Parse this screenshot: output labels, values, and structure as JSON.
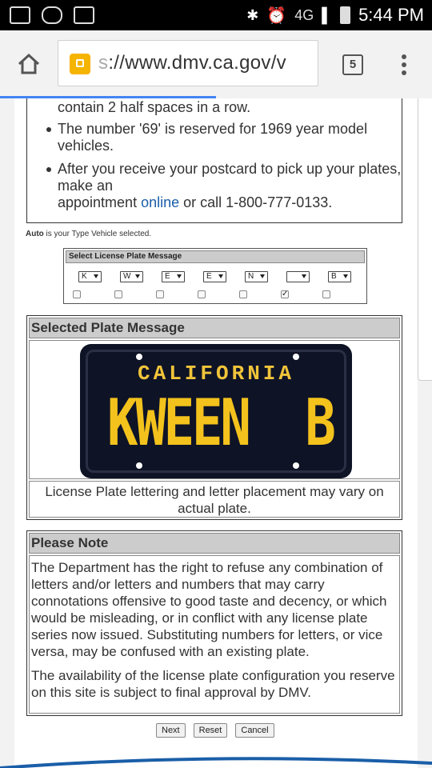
{
  "status_bar": {
    "network": "4G",
    "time": "5:44 PM"
  },
  "browser": {
    "url_prefix": "s",
    "url": "://www.dmv.ca.gov/v",
    "tab_count": "5"
  },
  "info_box": {
    "line_partial": "contain 2 half spaces in a row.",
    "bullet_69": "The number '69' is reserved for 1969 year model vehicles.",
    "bullet_69_line1": "The number '69' is reserved for 1969 year model",
    "bullet_69_line2": "vehicles.",
    "bullet_postcard_line1": "After you receive your postcard to pick up your plates,",
    "bullet_postcard_line2": "make an",
    "bullet_postcard_line3_pre": "appointment ",
    "link_online": "online",
    "bullet_postcard_line3_post": " or call 1-800-777-0133."
  },
  "vehicle_type": {
    "value": "Auto",
    "suffix": " is your Type Vehicle selected."
  },
  "selector": {
    "title": "Select License Plate Message",
    "chars": [
      "K",
      "W",
      "E",
      "E",
      "N",
      "",
      "B"
    ],
    "half_space_checked": [
      false,
      false,
      false,
      false,
      false,
      true,
      false
    ]
  },
  "selected_plate": {
    "heading": "Selected Plate Message",
    "state_name": "CALIFORNIA",
    "plate_text": "KWEEN  B",
    "caption": "License Plate lettering and letter placement may vary on actual plate."
  },
  "please_note": {
    "heading": "Please Note",
    "paragraph1": "The Department has the right to refuse any combination of letters and/or letters and numbers that may carry connotations offensive to good taste and decency, or which would be misleading, or in conflict with any license plate series now issued. Substituting numbers for letters, or vice versa, may be confused with an existing plate.",
    "paragraph2": "The availability of the license plate configuration you reserve on this site is subject to final approval by DMV."
  },
  "buttons": {
    "next": "Next",
    "reset": "Reset",
    "cancel": "Cancel"
  },
  "colors": {
    "progress": "#4285f4",
    "link": "#1a5ea8",
    "plate_bg": "#0e1326",
    "plate_text": "#f3c21c"
  }
}
